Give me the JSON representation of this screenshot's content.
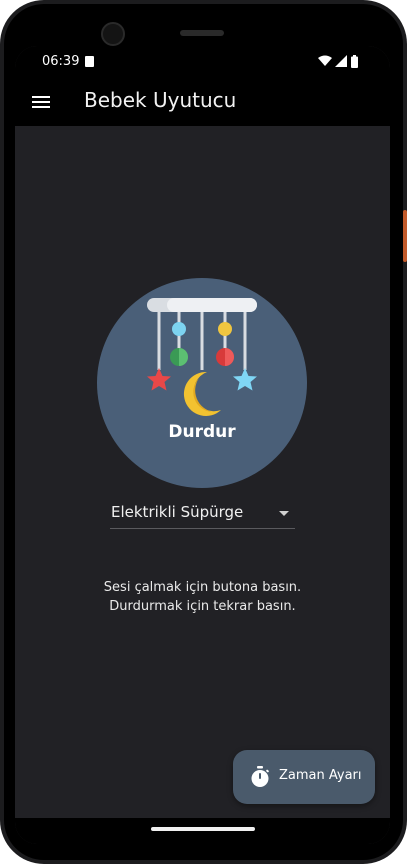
{
  "status_bar": {
    "time": "06:39"
  },
  "app_bar": {
    "title": "Bebek Uyutucu",
    "menu_icon": "menu-icon"
  },
  "player": {
    "button_label": "Durdur",
    "illustration": "baby-mobile-icon"
  },
  "sound_select": {
    "selected": "Elektrikli Süpürge"
  },
  "instructions": {
    "line1": "Sesi çalmak için butona basın.",
    "line2": "Durdurmak için tekrar basın."
  },
  "fab": {
    "label": "Zaman Ayarı",
    "icon": "timer-icon"
  },
  "colors": {
    "background": "#212125",
    "app_bar": "#000000",
    "circle": "#4a5f78",
    "fab": "#4a5a6b",
    "text": "#ffffff"
  }
}
